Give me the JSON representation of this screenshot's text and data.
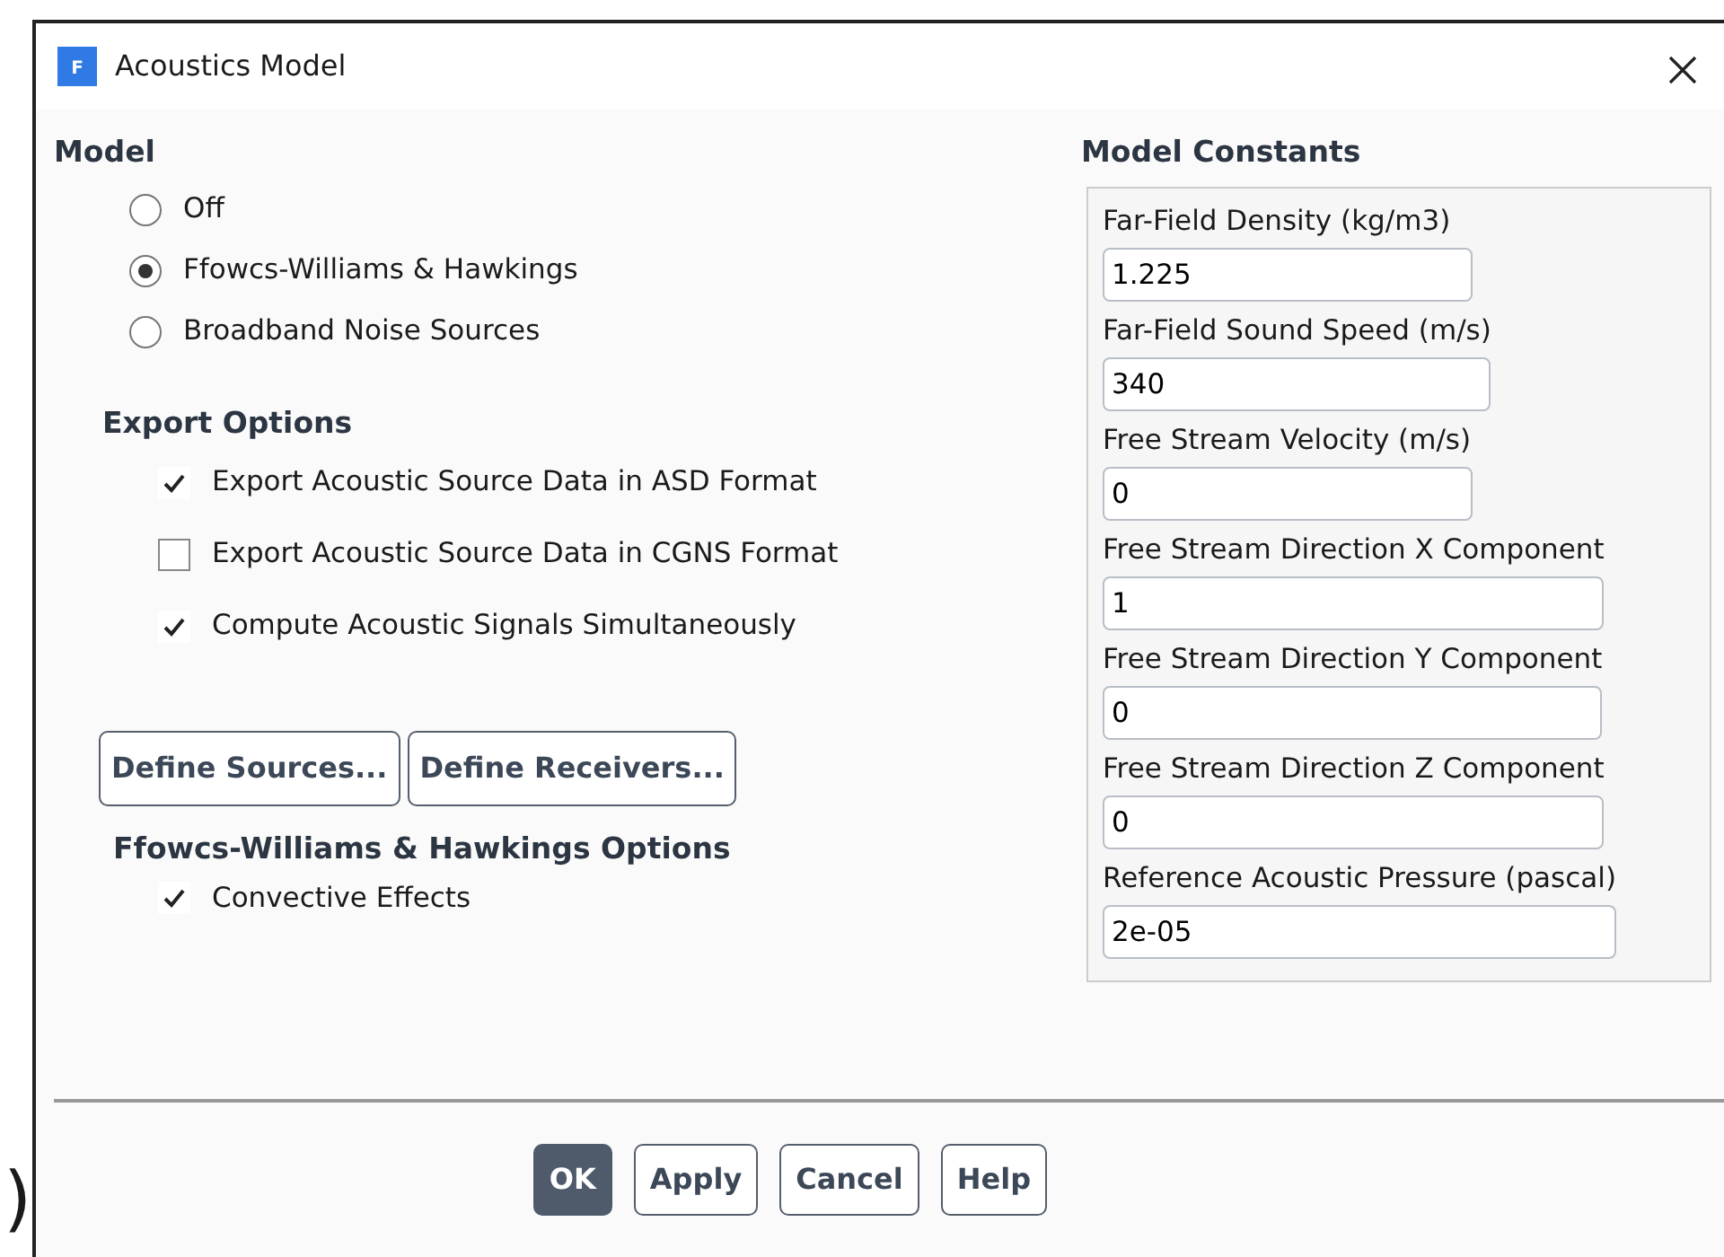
{
  "window": {
    "title": "Acoustics Model",
    "icon_letter": "F"
  },
  "model": {
    "heading": "Model",
    "options": [
      {
        "label": "Off",
        "selected": false
      },
      {
        "label": "Ffowcs-Williams & Hawkings",
        "selected": true
      },
      {
        "label": "Broadband Noise Sources",
        "selected": false
      }
    ]
  },
  "export_options": {
    "heading": "Export Options",
    "items": [
      {
        "label": "Export Acoustic Source Data in ASD Format",
        "checked": true
      },
      {
        "label": "Export Acoustic Source Data in CGNS Format",
        "checked": false
      },
      {
        "label": "Compute Acoustic Signals Simultaneously",
        "checked": true
      }
    ]
  },
  "define_buttons": [
    "Define Sources...",
    "Define Receivers..."
  ],
  "fwh_options": {
    "heading": "Ffowcs-Williams & Hawkings Options",
    "items": [
      {
        "label": "Convective Effects",
        "checked": true
      }
    ]
  },
  "model_constants": {
    "heading": "Model Constants",
    "fields": [
      {
        "label": "Far-Field Density (kg/m3)",
        "value": "1.225"
      },
      {
        "label": "Far-Field Sound Speed (m/s)",
        "value": "340"
      },
      {
        "label": "Free Stream Velocity (m/s)",
        "value": "0"
      },
      {
        "label": "Free Stream Direction X Component",
        "value": "1"
      },
      {
        "label": "Free Stream Direction Y Component",
        "value": "0"
      },
      {
        "label": "Free Stream Direction Z Component",
        "value": "0"
      },
      {
        "label": "Reference Acoustic Pressure (pascal)",
        "value": "2e-05"
      }
    ]
  },
  "buttons": [
    {
      "label": "OK",
      "kind": "primary"
    },
    {
      "label": "Apply",
      "kind": "plain"
    },
    {
      "label": "Cancel",
      "kind": "plain"
    },
    {
      "label": "Help",
      "kind": "plain"
    }
  ],
  "edge_text": ")"
}
